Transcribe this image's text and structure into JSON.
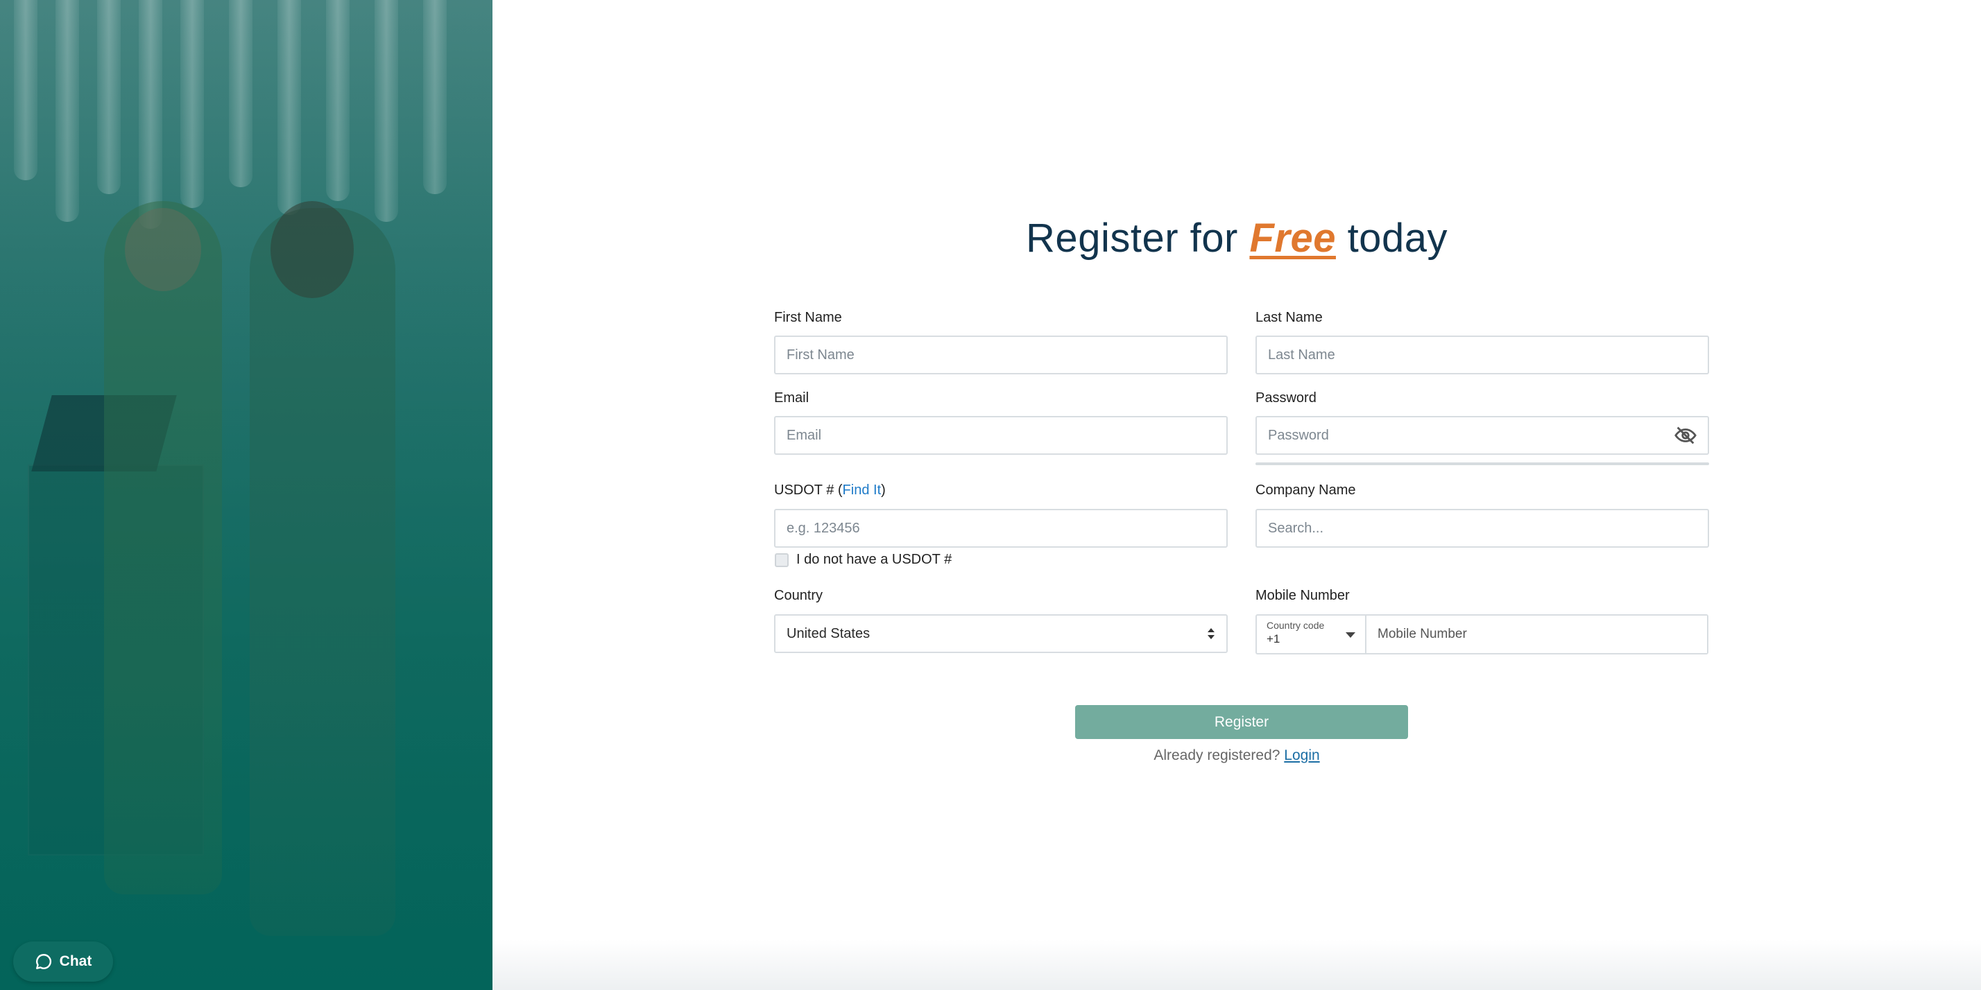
{
  "title": {
    "prefix": "Register for ",
    "highlight": "Free",
    "suffix": " today"
  },
  "form": {
    "first_name": {
      "label": "First Name",
      "placeholder": "First Name"
    },
    "last_name": {
      "label": "Last Name",
      "placeholder": "Last Name"
    },
    "email": {
      "label": "Email",
      "placeholder": "Email"
    },
    "password": {
      "label": "Password",
      "placeholder": "Password"
    },
    "usdot": {
      "label_prefix": "USDOT # (",
      "link": "Find It",
      "label_suffix": ")",
      "placeholder": "e.g. 123456",
      "no_usdot_label": "I do not have a USDOT #"
    },
    "company": {
      "label": "Company Name",
      "placeholder": "Search..."
    },
    "country": {
      "label": "Country",
      "selected": "United States"
    },
    "mobile": {
      "label": "Mobile Number",
      "country_code_caption": "Country code",
      "country_code_value": "+1",
      "placeholder": "Mobile Number"
    },
    "register_button": "Register",
    "already_registered": "Already registered?",
    "login_link": "Login"
  },
  "chat": {
    "label": "Chat"
  },
  "colors": {
    "title": "#12344d",
    "accent": "#e0782e",
    "button": "#73ac9e",
    "link": "#1f7bc8",
    "chat": "#0e6c62"
  }
}
